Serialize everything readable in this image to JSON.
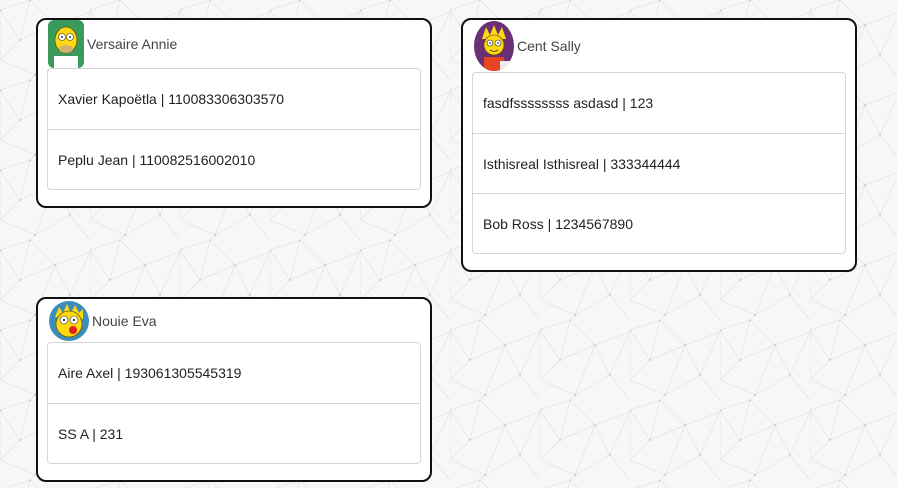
{
  "cards": [
    {
      "title": "Versaire Annie",
      "avatar": "homer-avatar",
      "items": [
        {
          "label": "Xavier Kapoëtla | 110083306303570"
        },
        {
          "label": "Peplu Jean | 110082516002010"
        }
      ]
    },
    {
      "title": "Cent Sally",
      "avatar": "lisa-avatar",
      "items": [
        {
          "label": "fasdfssssssss asdasd | 123"
        },
        {
          "label": "Isthisreal Isthisreal | 333344444"
        },
        {
          "label": "Bob Ross | 1234567890"
        }
      ]
    },
    {
      "title": "Nouie Eva",
      "avatar": "maggie-avatar",
      "items": [
        {
          "label": "Aire Axel | 193061305545319"
        },
        {
          "label": "SS A | 231"
        }
      ]
    }
  ],
  "colors": {
    "card_border": "#111111",
    "list_border": "#d6d6d6",
    "background": "#f7f7f7"
  }
}
